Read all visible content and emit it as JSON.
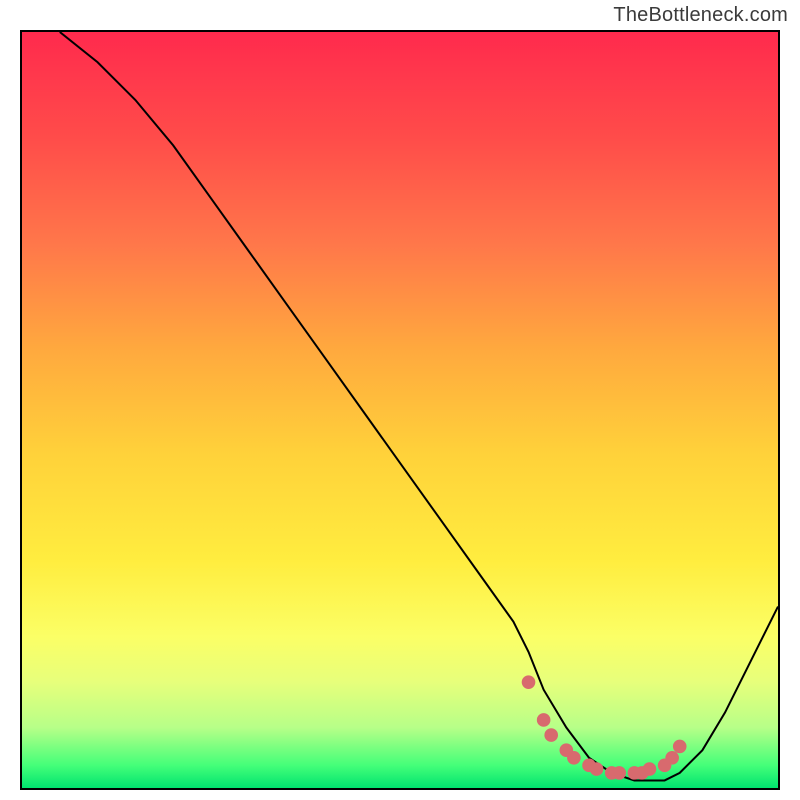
{
  "attribution": "TheBottleneck.com",
  "chart_data": {
    "type": "line",
    "title": "",
    "xlabel": "",
    "ylabel": "",
    "xlim": [
      0,
      100
    ],
    "ylim": [
      0,
      100
    ],
    "series": [
      {
        "name": "bottleneck-curve",
        "x": [
          5,
          10,
          15,
          20,
          25,
          30,
          35,
          40,
          45,
          50,
          55,
          60,
          65,
          67,
          69,
          72,
          75,
          78,
          81,
          83,
          85,
          87,
          90,
          93,
          96,
          100
        ],
        "y": [
          100,
          96,
          91,
          85,
          78,
          71,
          64,
          57,
          50,
          43,
          36,
          29,
          22,
          18,
          13,
          8,
          4,
          2,
          1,
          1,
          1,
          2,
          5,
          10,
          16,
          24
        ]
      }
    ],
    "markers": {
      "name": "emphasis-dots",
      "color": "#d86a6e",
      "x": [
        67,
        69,
        70,
        72,
        73,
        75,
        76,
        78,
        79,
        81,
        82,
        83,
        85,
        86,
        87
      ],
      "y": [
        14,
        9,
        7,
        5,
        4,
        3,
        2.5,
        2,
        2,
        2,
        2,
        2.5,
        3,
        4,
        5.5
      ]
    }
  }
}
